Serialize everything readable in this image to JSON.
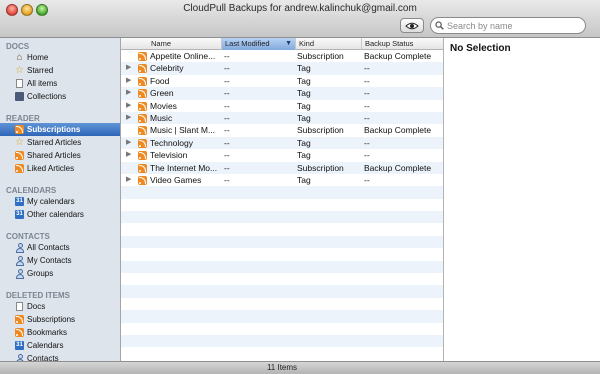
{
  "window": {
    "title": "CloudPull Backups for andrew.kalinchuk@gmail.com"
  },
  "toolbar": {
    "search_placeholder": "Search by name",
    "quick_look_icon": "eye-icon"
  },
  "sidebar": {
    "sections": [
      {
        "title": "DOCS",
        "items": [
          {
            "label": "Home",
            "icon": "house-icon"
          },
          {
            "label": "Starred",
            "icon": "star-icon"
          },
          {
            "label": "All items",
            "icon": "document-icon"
          },
          {
            "label": "Collections",
            "icon": "collection-icon"
          }
        ]
      },
      {
        "title": "READER",
        "items": [
          {
            "label": "Subscriptions",
            "icon": "rss-icon",
            "selected": true
          },
          {
            "label": "Starred Articles",
            "icon": "star-icon"
          },
          {
            "label": "Shared Articles",
            "icon": "rss-icon"
          },
          {
            "label": "Liked Articles",
            "icon": "rss-icon"
          }
        ]
      },
      {
        "title": "CALENDARS",
        "items": [
          {
            "label": "My calendars",
            "icon": "calendar-icon"
          },
          {
            "label": "Other calendars",
            "icon": "calendar-icon"
          }
        ]
      },
      {
        "title": "CONTACTS",
        "items": [
          {
            "label": "All Contacts",
            "icon": "person-icon"
          },
          {
            "label": "My Contacts",
            "icon": "person-icon"
          },
          {
            "label": "Groups",
            "icon": "person-icon"
          }
        ]
      },
      {
        "title": "DELETED ITEMS",
        "items": [
          {
            "label": "Docs",
            "icon": "document-icon"
          },
          {
            "label": "Subscriptions",
            "icon": "rss-icon"
          },
          {
            "label": "Bookmarks",
            "icon": "rss-icon"
          },
          {
            "label": "Calendars",
            "icon": "calendar-icon"
          },
          {
            "label": "Contacts",
            "icon": "person-icon"
          }
        ]
      }
    ],
    "calendar_glyph": "31"
  },
  "table": {
    "columns": [
      "Name",
      "Last Modified",
      "Kind",
      "Backup Status"
    ],
    "sort_indicator": "▼",
    "rows": [
      {
        "name": "Appetite Online...",
        "modified": "--",
        "kind": "Subscription",
        "status": "Backup Complete",
        "expandable": false
      },
      {
        "name": "Celebrity",
        "modified": "--",
        "kind": "Tag",
        "status": "--",
        "expandable": true
      },
      {
        "name": "Food",
        "modified": "--",
        "kind": "Tag",
        "status": "--",
        "expandable": true
      },
      {
        "name": "Green",
        "modified": "--",
        "kind": "Tag",
        "status": "--",
        "expandable": true
      },
      {
        "name": "Movies",
        "modified": "--",
        "kind": "Tag",
        "status": "--",
        "expandable": true
      },
      {
        "name": "Music",
        "modified": "--",
        "kind": "Tag",
        "status": "--",
        "expandable": true
      },
      {
        "name": "Music | Slant M...",
        "modified": "--",
        "kind": "Subscription",
        "status": "Backup Complete",
        "expandable": false
      },
      {
        "name": "Technology",
        "modified": "--",
        "kind": "Tag",
        "status": "--",
        "expandable": true
      },
      {
        "name": "Television",
        "modified": "--",
        "kind": "Tag",
        "status": "--",
        "expandable": true
      },
      {
        "name": "The Internet Mo...",
        "modified": "--",
        "kind": "Subscription",
        "status": "Backup Complete",
        "expandable": false
      },
      {
        "name": "Video Games",
        "modified": "--",
        "kind": "Tag",
        "status": "--",
        "expandable": true
      }
    ]
  },
  "detail": {
    "title": "No Selection"
  },
  "status_bar": {
    "count": "11 Items"
  },
  "colors": {
    "selection": "#3a73c4",
    "sidebar_bg": "#dde4ec",
    "rss_orange": "#ee8a21",
    "row_alt": "#edf3fb"
  }
}
